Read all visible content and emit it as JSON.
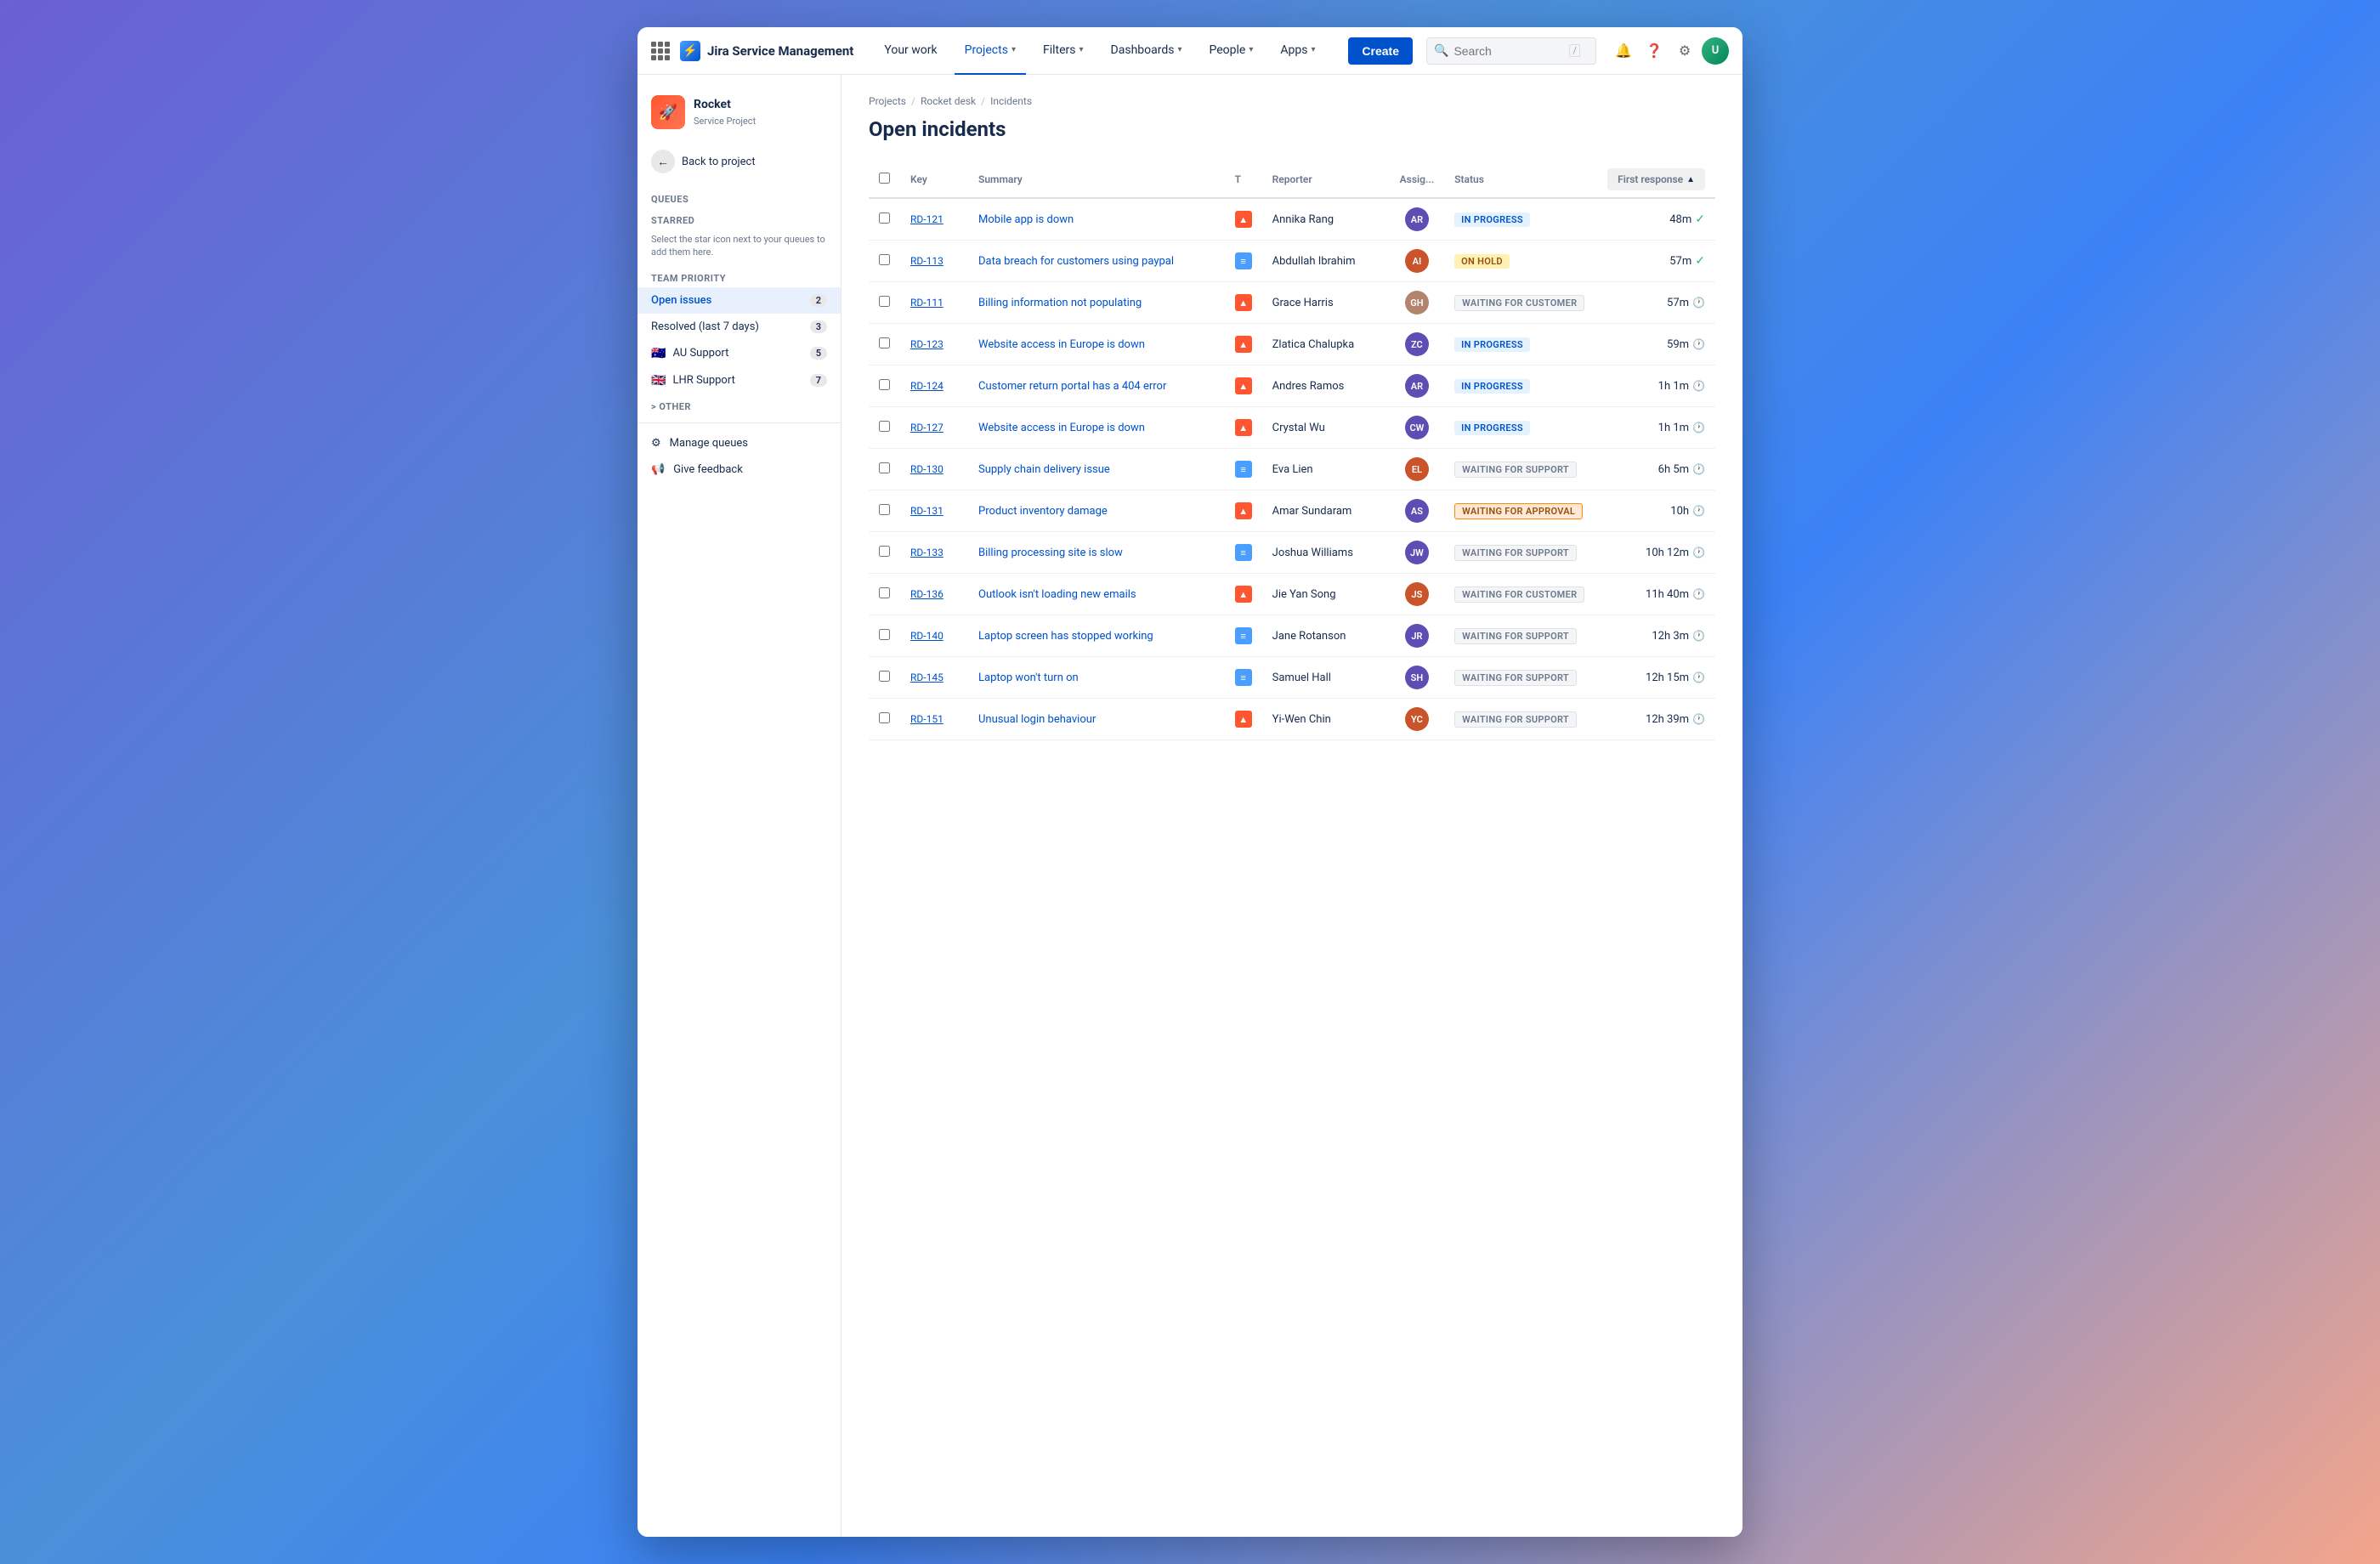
{
  "brand": {
    "name": "Jira Service Management",
    "logo_char": "⚡"
  },
  "nav": {
    "items": [
      {
        "label": "Your work",
        "active": false
      },
      {
        "label": "Projects",
        "active": true,
        "has_chevron": true
      },
      {
        "label": "Filters",
        "active": false,
        "has_chevron": true
      },
      {
        "label": "Dashboards",
        "active": false,
        "has_chevron": true
      },
      {
        "label": "People",
        "active": false,
        "has_chevron": true
      },
      {
        "label": "Apps",
        "active": false,
        "has_chevron": true
      }
    ],
    "create_label": "Create",
    "search_placeholder": "Search"
  },
  "project": {
    "name": "Rocket",
    "type": "Service Project",
    "icon_char": "🚀"
  },
  "sidebar": {
    "back_label": "Back to project",
    "queues_label": "Queues",
    "starred_label": "STARRED",
    "starred_note": "Select the star icon next to your queues to add them here.",
    "team_priority_label": "TEAM PRIORITY",
    "other_label": "> OTHER",
    "items": [
      {
        "label": "Open issues",
        "count": 2,
        "active": true
      },
      {
        "label": "Resolved (last 7 days)",
        "count": 3,
        "active": false
      },
      {
        "label": "AU Support",
        "count": 5,
        "active": false,
        "flag": "🇦🇺"
      },
      {
        "label": "LHR Support",
        "count": 7,
        "active": false,
        "flag": "🇬🇧"
      }
    ],
    "manage_queues_label": "Manage queues",
    "give_feedback_label": "Give feedback"
  },
  "breadcrumb": {
    "items": [
      "Projects",
      "Rocket desk",
      "Incidents"
    ]
  },
  "page_title": "Open incidents",
  "table": {
    "columns": {
      "key": "Key",
      "summary": "Summary",
      "type": "T",
      "reporter": "Reporter",
      "assignee": "Assig...",
      "status": "Status",
      "first_response": "First response"
    },
    "rows": [
      {
        "key": "RD-121",
        "summary": "Mobile app is down",
        "type": "incident",
        "reporter": "Annika Rang",
        "assignee_initials": "AR",
        "assignee_color": "#5e4db2",
        "status": "IN PROGRESS",
        "status_class": "status-in-progress",
        "first_response": "48m",
        "fr_icon": "check"
      },
      {
        "key": "RD-113",
        "summary": "Data breach for customers using paypal",
        "type": "service",
        "reporter": "Abdullah Ibrahim",
        "assignee_initials": "AI",
        "assignee_color": "#c9532a",
        "status": "ON HOLD",
        "status_class": "status-on-hold",
        "first_response": "57m",
        "fr_icon": "check"
      },
      {
        "key": "RD-111",
        "summary": "Billing information not populating",
        "type": "incident",
        "reporter": "Grace Harris",
        "assignee_initials": "GH",
        "assignee_color": "#b3846d",
        "status": "WAITING FOR CUSTOMER",
        "status_class": "status-waiting-customer",
        "first_response": "57m",
        "fr_icon": "clock"
      },
      {
        "key": "RD-123",
        "summary": "Website access in Europe is down",
        "type": "incident",
        "reporter": "Zlatica Chalupka",
        "assignee_initials": "ZC",
        "assignee_color": "#5e4db2",
        "status": "IN PROGRESS",
        "status_class": "status-in-progress",
        "first_response": "59m",
        "fr_icon": "clock"
      },
      {
        "key": "RD-124",
        "summary": "Customer return portal has a 404 error",
        "type": "incident",
        "reporter": "Andres Ramos",
        "assignee_initials": "AR",
        "assignee_color": "#5e4db2",
        "status": "IN PROGRESS",
        "status_class": "status-in-progress",
        "first_response": "1h 1m",
        "fr_icon": "clock"
      },
      {
        "key": "RD-127",
        "summary": "Website access in Europe is down",
        "type": "incident",
        "reporter": "Crystal Wu",
        "assignee_initials": "CW",
        "assignee_color": "#5e4db2",
        "status": "IN PROGRESS",
        "status_class": "status-in-progress",
        "first_response": "1h 1m",
        "fr_icon": "clock"
      },
      {
        "key": "RD-130",
        "summary": "Supply chain delivery issue",
        "type": "service",
        "reporter": "Eva Lien",
        "assignee_initials": "EL",
        "assignee_color": "#c9532a",
        "status": "WAITING FOR SUPPORT",
        "status_class": "status-waiting-support",
        "first_response": "6h 5m",
        "fr_icon": "clock"
      },
      {
        "key": "RD-131",
        "summary": "Product inventory damage",
        "type": "incident",
        "reporter": "Amar Sundaram",
        "assignee_initials": "AS",
        "assignee_color": "#5e4db2",
        "status": "WAITING FOR APPROVAL",
        "status_class": "status-waiting-approval",
        "first_response": "10h",
        "fr_icon": "clock"
      },
      {
        "key": "RD-133",
        "summary": "Billing processing site is slow",
        "type": "service",
        "reporter": "Joshua Williams",
        "assignee_initials": "JW",
        "assignee_color": "#5e4db2",
        "status": "WAITING FOR SUPPORT",
        "status_class": "status-waiting-support",
        "first_response": "10h 12m",
        "fr_icon": "clock"
      },
      {
        "key": "RD-136",
        "summary": "Outlook isn't loading new emails",
        "type": "incident",
        "reporter": "Jie Yan Song",
        "assignee_initials": "JS",
        "assignee_color": "#c9532a",
        "status": "WAITING FOR CUSTOMER",
        "status_class": "status-waiting-customer",
        "first_response": "11h 40m",
        "fr_icon": "clock"
      },
      {
        "key": "RD-140",
        "summary": "Laptop screen has stopped working",
        "type": "service",
        "reporter": "Jane Rotanson",
        "assignee_initials": "JR",
        "assignee_color": "#5e4db2",
        "status": "WAITING FOR SUPPORT",
        "status_class": "status-waiting-support",
        "first_response": "12h 3m",
        "fr_icon": "clock"
      },
      {
        "key": "RD-145",
        "summary": "Laptop won't turn on",
        "type": "service",
        "reporter": "Samuel Hall",
        "assignee_initials": "SH",
        "assignee_color": "#5e4db2",
        "status": "WAITING FOR SUPPORT",
        "status_class": "status-waiting-support",
        "first_response": "12h 15m",
        "fr_icon": "clock"
      },
      {
        "key": "RD-151",
        "summary": "Unusual login behaviour",
        "type": "incident",
        "reporter": "Yi-Wen Chin",
        "assignee_initials": "YC",
        "assignee_color": "#c9532a",
        "status": "WAITING FOR SUPPORT",
        "status_class": "status-waiting-support",
        "first_response": "12h 39m",
        "fr_icon": "clock"
      }
    ]
  }
}
